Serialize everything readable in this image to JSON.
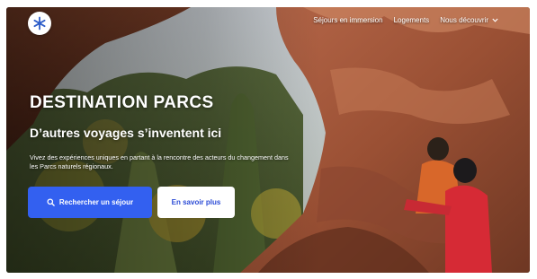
{
  "header": {
    "logo_icon": "snowflake-star-icon",
    "nav": [
      {
        "label": "Séjours en immersion"
      },
      {
        "label": "Logements"
      },
      {
        "label": "Nous découvrir",
        "icon": "chevron-down-icon"
      }
    ]
  },
  "hero": {
    "title": "DESTINATION PARCS",
    "subtitle": "D’autres voyages s’inventent ici",
    "description": "Vivez des expériences uniques en partant à la rencontre des acteurs du changement dans les Parcs naturels régionaux.",
    "primary_button": {
      "label": "Rechercher un séjour",
      "icon": "search-icon"
    },
    "secondary_button": {
      "label": "En savoir plus"
    }
  },
  "colors": {
    "primary": "#3360f0",
    "secondary_text": "#2b4bd6",
    "logo_star": "#2f5ec9"
  }
}
